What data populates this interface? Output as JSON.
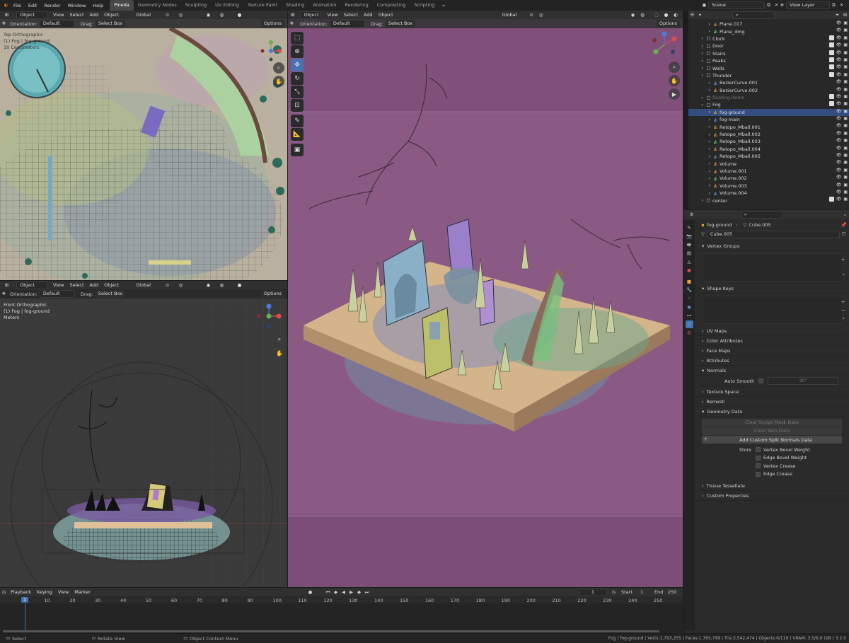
{
  "topbar": {
    "menus": [
      "File",
      "Edit",
      "Render",
      "Window",
      "Help"
    ],
    "workspaces": [
      "Pineda",
      "Geometry Nodes",
      "Sculpting",
      "UV Editing",
      "Texture Paint",
      "Shading",
      "Animation",
      "Rendering",
      "Compositing",
      "Scripting"
    ],
    "active_workspace": "Pineda",
    "add_tab": "+"
  },
  "viewport_common": {
    "mode": "Object Mode",
    "view": "View",
    "select": "Select",
    "add": "Add",
    "object": "Object",
    "transform": "Global",
    "orientation_label": "Orientation:",
    "orientation_value": "Default",
    "drag_label": "Drag:",
    "drag_value": "Select Box",
    "options": "Options"
  },
  "viewport_top": {
    "view_name": "Top Orthographic",
    "collection": "(1) Fog | fog-ground",
    "scale": "10 Centimeters"
  },
  "viewport_front": {
    "view_name": "Front Orthographic",
    "collection": "(1) Fog | fog-ground",
    "scale": "Meters"
  },
  "outliner": {
    "scene_label": "Scene",
    "view_layer": "View Layer",
    "rows": [
      {
        "name": "Plane.017",
        "indent": 2
      },
      {
        "name": "Plane_dmg",
        "indent": 2
      },
      {
        "name": "Clock",
        "indent": 1
      },
      {
        "name": "Door",
        "indent": 1
      },
      {
        "name": "Stairs",
        "indent": 1
      },
      {
        "name": "Peaks",
        "indent": 1
      },
      {
        "name": "Walls",
        "indent": 1
      },
      {
        "name": "Thunder",
        "indent": 1
      },
      {
        "name": "BezierCurve.001",
        "indent": 2
      },
      {
        "name": "BezierCurve.002",
        "indent": 2
      },
      {
        "name": "floating-items",
        "indent": 1
      },
      {
        "name": "Fog",
        "indent": 1
      },
      {
        "name": "fog-ground",
        "indent": 2
      },
      {
        "name": "fog-main",
        "indent": 2
      },
      {
        "name": "Retopo_Mball.001",
        "indent": 2
      },
      {
        "name": "Retopo_Mball.002",
        "indent": 2
      },
      {
        "name": "Retopo_Mball.003",
        "indent": 2
      },
      {
        "name": "Retopo_Mball.004",
        "indent": 2
      },
      {
        "name": "Retopo_Mball.005",
        "indent": 2
      },
      {
        "name": "Volume",
        "indent": 2
      },
      {
        "name": "Volume.001",
        "indent": 2
      },
      {
        "name": "Volume.002",
        "indent": 2
      },
      {
        "name": "Volume.003",
        "indent": 2
      },
      {
        "name": "Volume.004",
        "indent": 2
      },
      {
        "name": "center",
        "indent": 1
      }
    ]
  },
  "properties": {
    "breadcrumb_object": "fog-ground",
    "breadcrumb_mesh": "Cube.005",
    "mesh_name": "Cube.005",
    "panels": {
      "vertex_groups": "Vertex Groups",
      "shape_keys": "Shape Keys",
      "uv_maps": "UV Maps",
      "color_attributes": "Color Attributes",
      "face_maps": "Face Maps",
      "attributes": "Attributes",
      "normals": "Normals",
      "auto_smooth": "Auto Smooth",
      "auto_smooth_angle": "30°",
      "texture_space": "Texture Space",
      "remesh": "Remesh",
      "geometry_data": "Geometry Data",
      "clear_sculpt": "Clear Sculpt Mask Data",
      "clear_skin": "Clear Skin Data",
      "add_split_normals": "Add Custom Split Normals Data",
      "store_label": "Store",
      "store_options": [
        "Vertex Bevel Weight",
        "Edge Bevel Weight",
        "Vertex Crease",
        "Edge Crease"
      ],
      "texture_tessellate": "Tissue Tessellate",
      "custom_properties": "Custom Properties"
    }
  },
  "timeline": {
    "menus": [
      "Playback",
      "Keying",
      "View",
      "Marker"
    ],
    "current_frame": "1",
    "start_label": "Start",
    "start": "1",
    "end_label": "End",
    "end": "250",
    "frame_marker": "1",
    "ticks": [
      "10",
      "20",
      "30",
      "40",
      "50",
      "60",
      "70",
      "80",
      "90",
      "100",
      "110",
      "120",
      "130",
      "140",
      "150",
      "160",
      "170",
      "180",
      "190",
      "200",
      "210",
      "220",
      "230",
      "240",
      "250"
    ]
  },
  "statusbar": {
    "select": "Select",
    "rotate": "Rotate View",
    "context": "Object Context Menu",
    "stats": "Fog | fog-ground | Verts:1,793,255 | Faces:1,765,799 | Tris:3,542,474 | Objects:0/119 | VRAM: 3.5/6.0 GiB | 3.2.0"
  },
  "colors": {
    "accent": "#4772b3",
    "viewport_bg": "#8a5a84",
    "top_view_bg": "#b9b0a0",
    "front_view_bg": "#3a3a3a",
    "panel": "#303030"
  }
}
